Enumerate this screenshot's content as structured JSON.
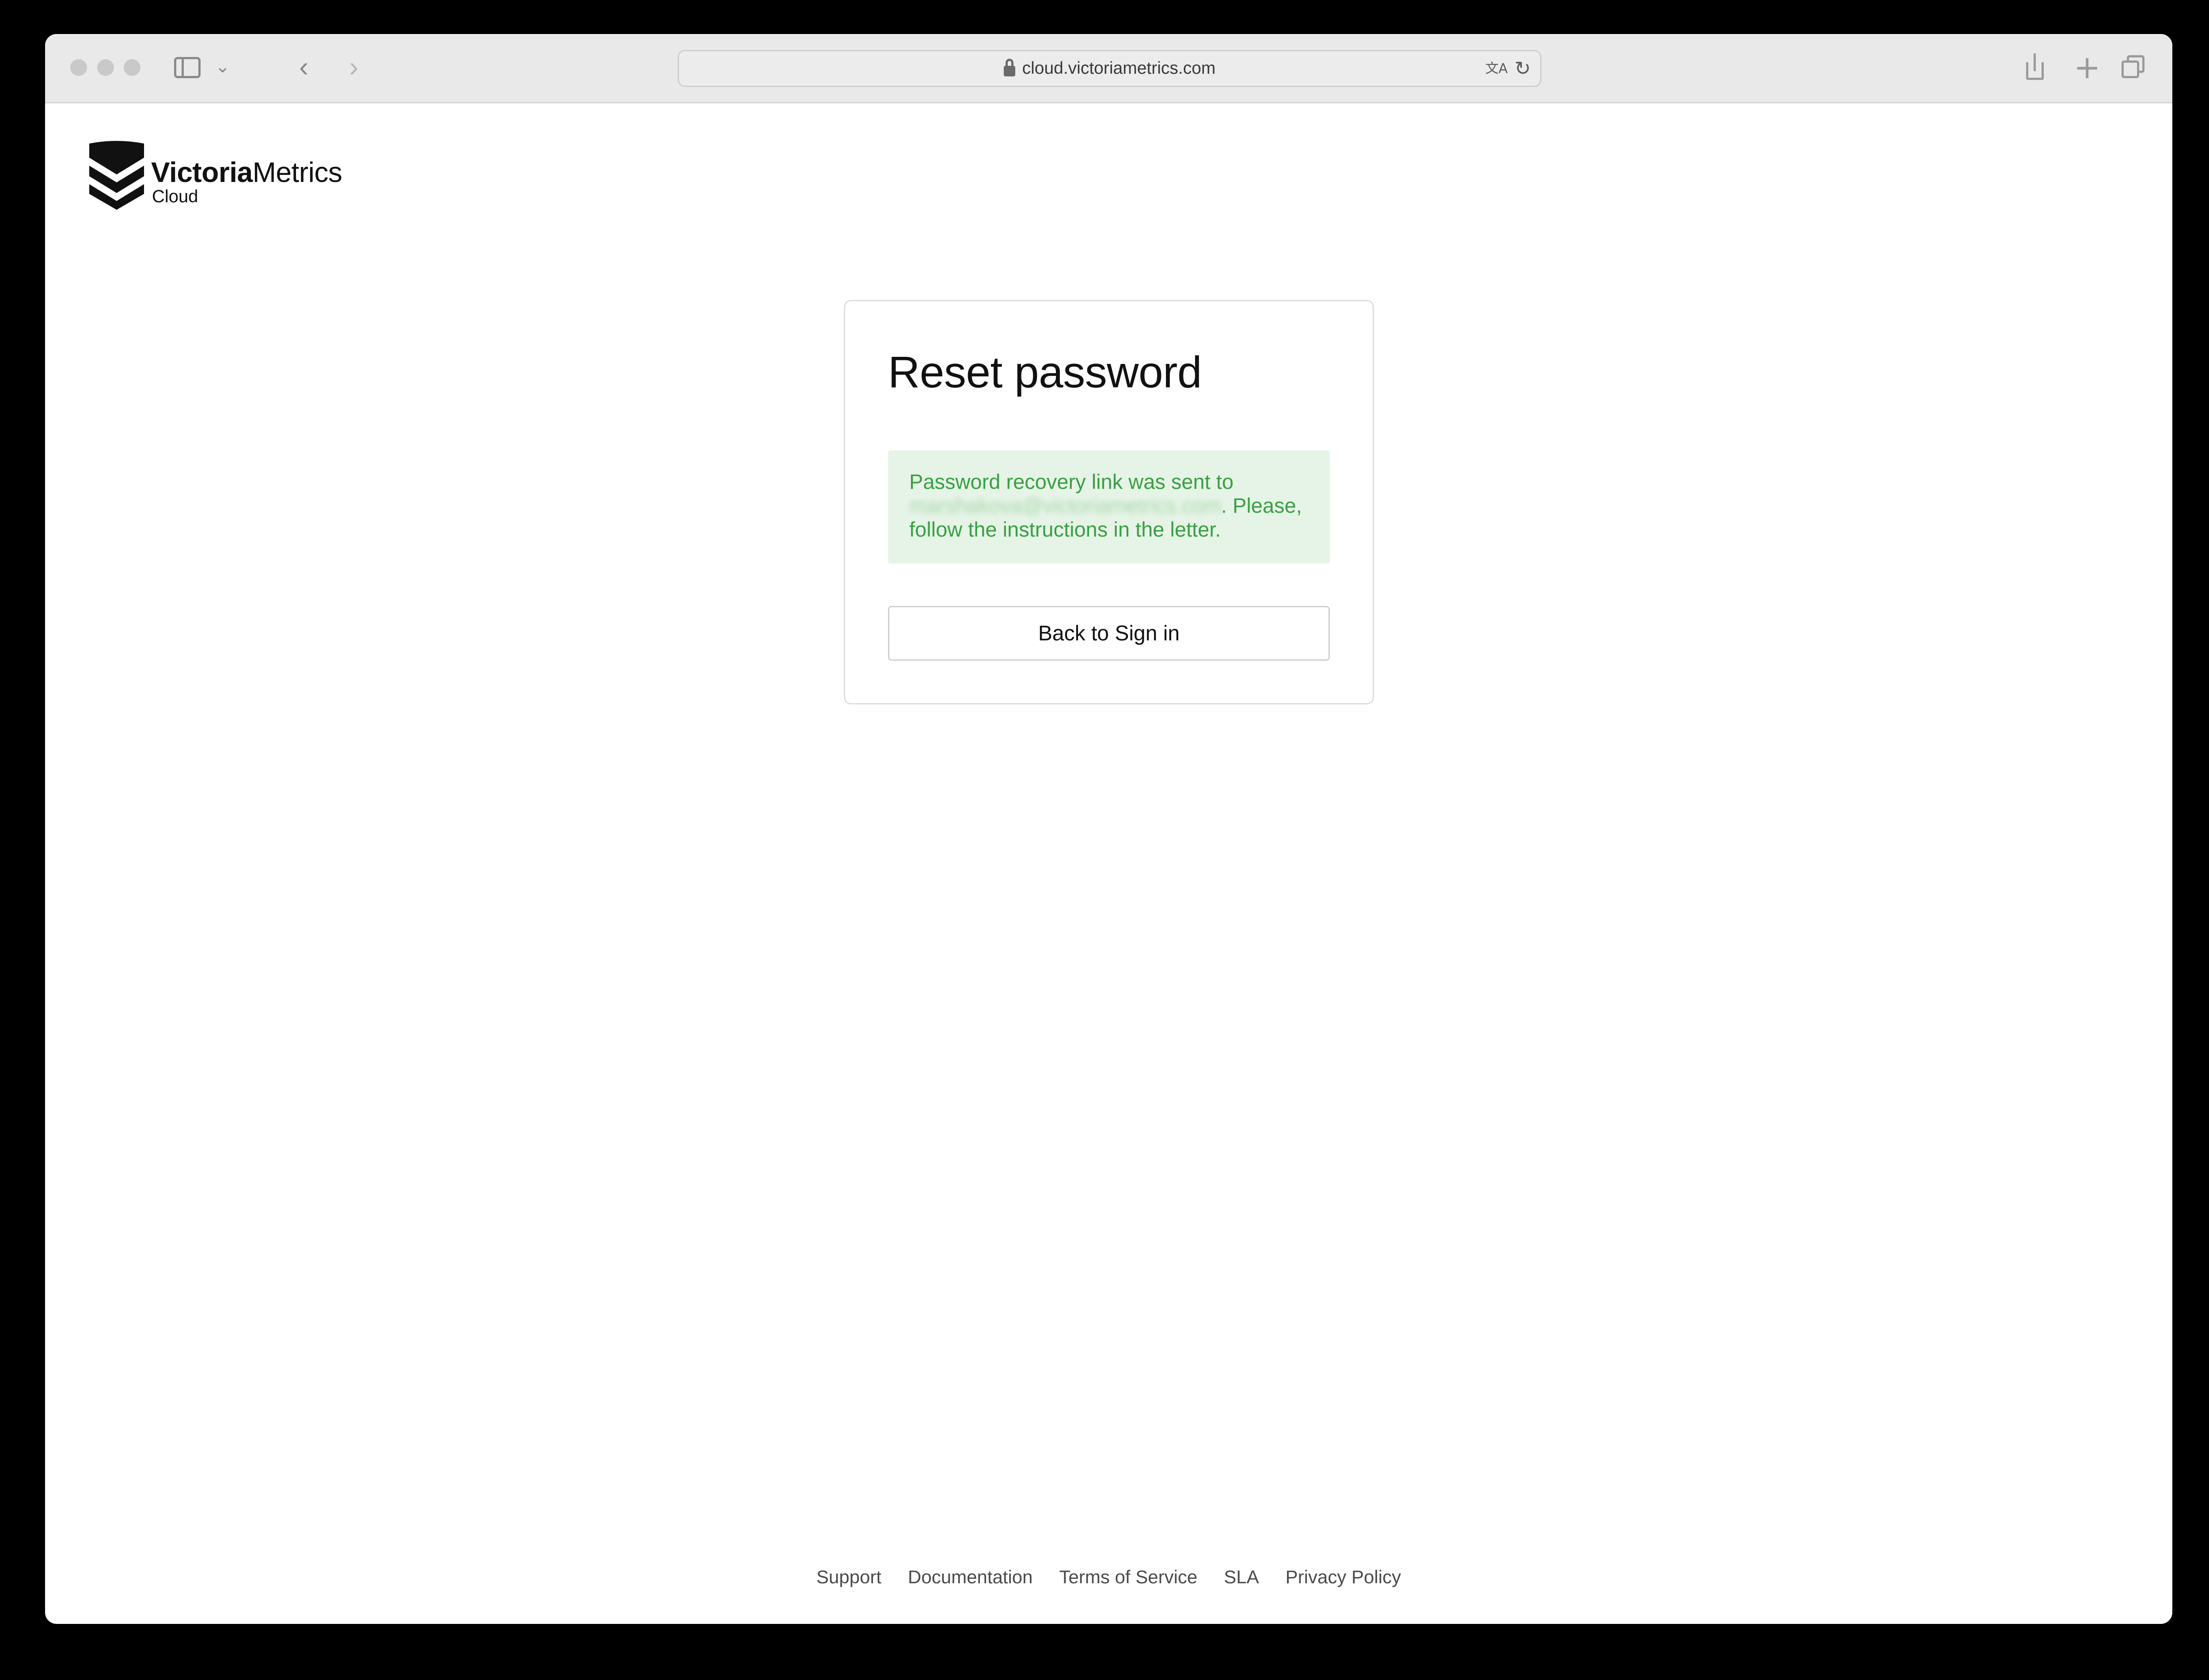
{
  "browser": {
    "url": "cloud.victoriametrics.com",
    "icons": [
      "sidebar-icon",
      "chevron-down-icon",
      "back-arrow-icon",
      "forward-arrow-icon",
      "lock-icon",
      "translate-icon",
      "reload-icon",
      "share-icon",
      "plus-icon",
      "tabs-overview-icon"
    ]
  },
  "logo": {
    "word_bold": "Victoria",
    "word_regular": "Metrics",
    "sub": "Cloud"
  },
  "card": {
    "title": "Reset password",
    "alert": {
      "prefix": "Password recovery link was sent to",
      "email": "marshakova@victoriametrics.com",
      "suffix": ". Please, follow the instructions in the letter."
    },
    "back_button": "Back to Sign in"
  },
  "footer": {
    "links": [
      "Support",
      "Documentation",
      "Terms of Service",
      "SLA",
      "Privacy Policy"
    ]
  },
  "colors": {
    "alert_bg": "#e6f4e7",
    "alert_text": "#3a9f43",
    "title_text": "#111111"
  }
}
